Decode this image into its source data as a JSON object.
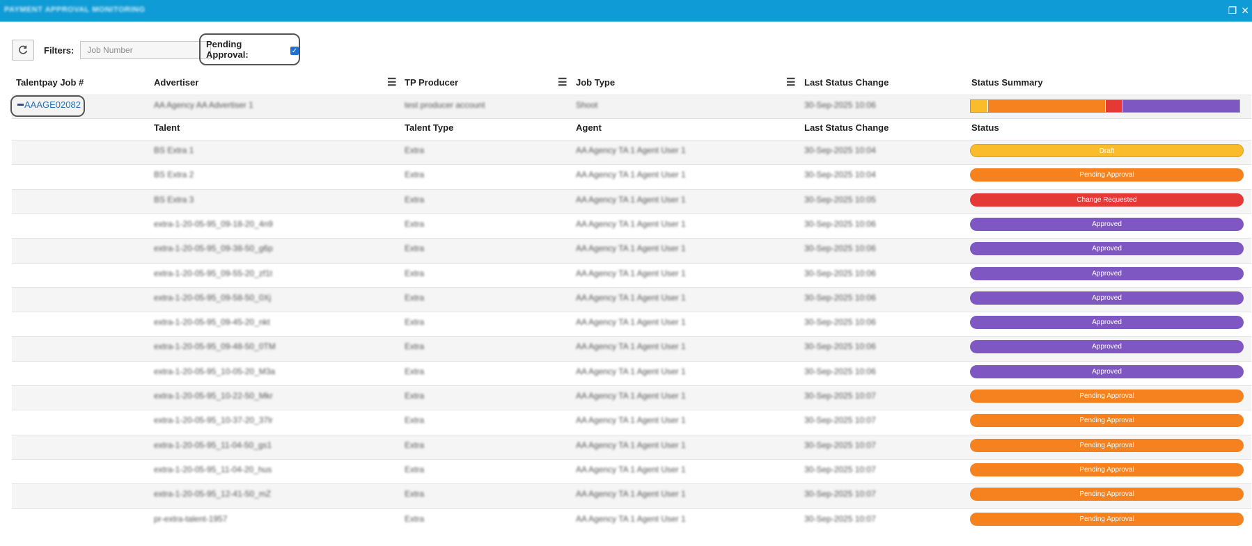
{
  "window": {
    "title": "PAYMENT APPROVAL MONITORING"
  },
  "toolbar": {
    "refresh_icon": "refresh-icon",
    "filters_label": "Filters:",
    "job_number_placeholder": "Job Number",
    "pending_approval_label": "Pending Approval:",
    "pending_approval_checked": true
  },
  "columns": [
    "Talentpay Job #",
    "Advertiser",
    "TP Producer",
    "Job Type",
    "Last Status Change",
    "Status Summary"
  ],
  "job": {
    "number": "AAAGE02082",
    "advertiser": "AA Agency AA Advertiser 1",
    "producer": "test producer account",
    "job_type": "Shoot",
    "last_status_change": "30-Sep-2025 10:06",
    "summary_segments": [
      {
        "status": "Draft",
        "count": 1,
        "color": "#fbbc2b"
      },
      {
        "status": "Pending Approval",
        "count": 7,
        "color": "#f5821f"
      },
      {
        "status": "Change Requested",
        "count": 1,
        "color": "#e53935"
      },
      {
        "status": "Approved",
        "count": 7,
        "color": "#7e57c2"
      }
    ]
  },
  "subcolumns": [
    "Talent",
    "Talent Type",
    "Agent",
    "Last Status Change",
    "Status"
  ],
  "status_colors": {
    "Draft": "#fbbc2b",
    "Pending Approval": "#f5821f",
    "Change Requested": "#e53935",
    "Approved": "#7e57c2"
  },
  "talent_rows": [
    {
      "talent": "BS Extra 1",
      "type": "Extra",
      "agent": "AA Agency TA 1 Agent User 1",
      "date": "30-Sep-2025 10:04",
      "status": "Draft"
    },
    {
      "talent": "BS Extra 2",
      "type": "Extra",
      "agent": "AA Agency TA 1 Agent User 1",
      "date": "30-Sep-2025 10:04",
      "status": "Pending Approval"
    },
    {
      "talent": "BS Extra 3",
      "type": "Extra",
      "agent": "AA Agency TA 1 Agent User 1",
      "date": "30-Sep-2025 10:05",
      "status": "Change Requested"
    },
    {
      "talent": "extra-1-20-05-95_09-18-20_4n9",
      "type": "Extra",
      "agent": "AA Agency TA 1 Agent User 1",
      "date": "30-Sep-2025 10:06",
      "status": "Approved"
    },
    {
      "talent": "extra-1-20-05-95_09-38-50_g6p",
      "type": "Extra",
      "agent": "AA Agency TA 1 Agent User 1",
      "date": "30-Sep-2025 10:06",
      "status": "Approved"
    },
    {
      "talent": "extra-1-20-05-95_09-55-20_zf1t",
      "type": "Extra",
      "agent": "AA Agency TA 1 Agent User 1",
      "date": "30-Sep-2025 10:06",
      "status": "Approved"
    },
    {
      "talent": "extra-1-20-05-95_09-58-50_0Xj",
      "type": "Extra",
      "agent": "AA Agency TA 1 Agent User 1",
      "date": "30-Sep-2025 10:06",
      "status": "Approved"
    },
    {
      "talent": "extra-1-20-05-95_09-45-20_nkt",
      "type": "Extra",
      "agent": "AA Agency TA 1 Agent User 1",
      "date": "30-Sep-2025 10:06",
      "status": "Approved"
    },
    {
      "talent": "extra-1-20-05-95_09-48-50_0TM",
      "type": "Extra",
      "agent": "AA Agency TA 1 Agent User 1",
      "date": "30-Sep-2025 10:06",
      "status": "Approved"
    },
    {
      "talent": "extra-1-20-05-95_10-05-20_M3a",
      "type": "Extra",
      "agent": "AA Agency TA 1 Agent User 1",
      "date": "30-Sep-2025 10:06",
      "status": "Approved"
    },
    {
      "talent": "extra-1-20-05-95_10-22-50_Mkr",
      "type": "Extra",
      "agent": "AA Agency TA 1 Agent User 1",
      "date": "30-Sep-2025 10:07",
      "status": "Pending Approval"
    },
    {
      "talent": "extra-1-20-05-95_10-37-20_37lr",
      "type": "Extra",
      "agent": "AA Agency TA 1 Agent User 1",
      "date": "30-Sep-2025 10:07",
      "status": "Pending Approval"
    },
    {
      "talent": "extra-1-20-05-95_11-04-50_gs1",
      "type": "Extra",
      "agent": "AA Agency TA 1 Agent User 1",
      "date": "30-Sep-2025 10:07",
      "status": "Pending Approval"
    },
    {
      "talent": "extra-1-20-05-95_11-04-20_hus",
      "type": "Extra",
      "agent": "AA Agency TA 1 Agent User 1",
      "date": "30-Sep-2025 10:07",
      "status": "Pending Approval"
    },
    {
      "talent": "extra-1-20-05-95_12-41-50_mZ",
      "type": "Extra",
      "agent": "AA Agency TA 1 Agent User 1",
      "date": "30-Sep-2025 10:07",
      "status": "Pending Approval"
    },
    {
      "talent": "pr-extra-talent-1957",
      "type": "Extra",
      "agent": "AA Agency TA 1 Agent User 1",
      "date": "30-Sep-2025 10:07",
      "status": "Pending Approval"
    }
  ]
}
